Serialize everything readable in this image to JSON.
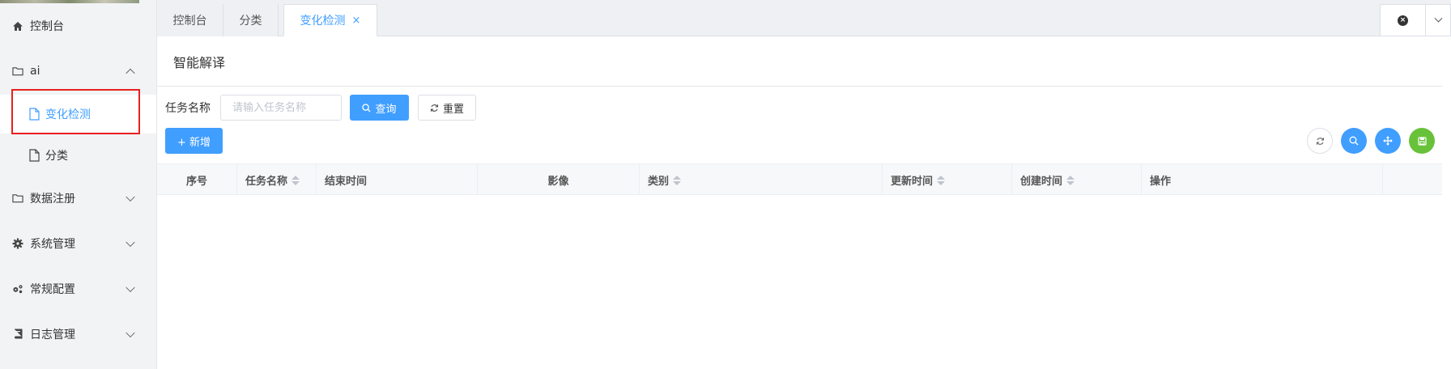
{
  "sidebar": {
    "items": [
      {
        "label": "控制台",
        "icon": "home-icon"
      },
      {
        "label": "ai",
        "icon": "folder-icon",
        "expanded": true,
        "children": [
          {
            "label": "变化检测",
            "icon": "file-icon",
            "active": true
          },
          {
            "label": "分类",
            "icon": "file-icon"
          }
        ]
      },
      {
        "label": "数据注册",
        "icon": "folder-icon"
      },
      {
        "label": "系统管理",
        "icon": "gear-icon"
      },
      {
        "label": "常规配置",
        "icon": "gears-icon"
      },
      {
        "label": "日志管理",
        "icon": "book-icon"
      }
    ]
  },
  "tabs": [
    {
      "label": "控制台"
    },
    {
      "label": "分类"
    },
    {
      "label": "变化检测",
      "active": true,
      "close": "×"
    }
  ],
  "panel": {
    "title": "智能解译"
  },
  "search": {
    "label": "任务名称",
    "placeholder": "请输入任务名称",
    "query_label": "查询",
    "reset_label": "重置"
  },
  "toolbar": {
    "add_label": "+ 新增"
  },
  "table": {
    "columns": [
      {
        "label": "序号",
        "sortable": false
      },
      {
        "label": "任务名称",
        "sortable": true
      },
      {
        "label": "结束时间",
        "sortable": false
      },
      {
        "label": "影像",
        "sortable": false
      },
      {
        "label": "类别",
        "sortable": true
      },
      {
        "label": "更新时间",
        "sortable": true
      },
      {
        "label": "创建时间",
        "sortable": true
      },
      {
        "label": "操作",
        "sortable": false
      }
    ],
    "rows": []
  },
  "colors": {
    "primary": "#409eff",
    "success": "#67c23a",
    "highlight": "#e8201f"
  }
}
